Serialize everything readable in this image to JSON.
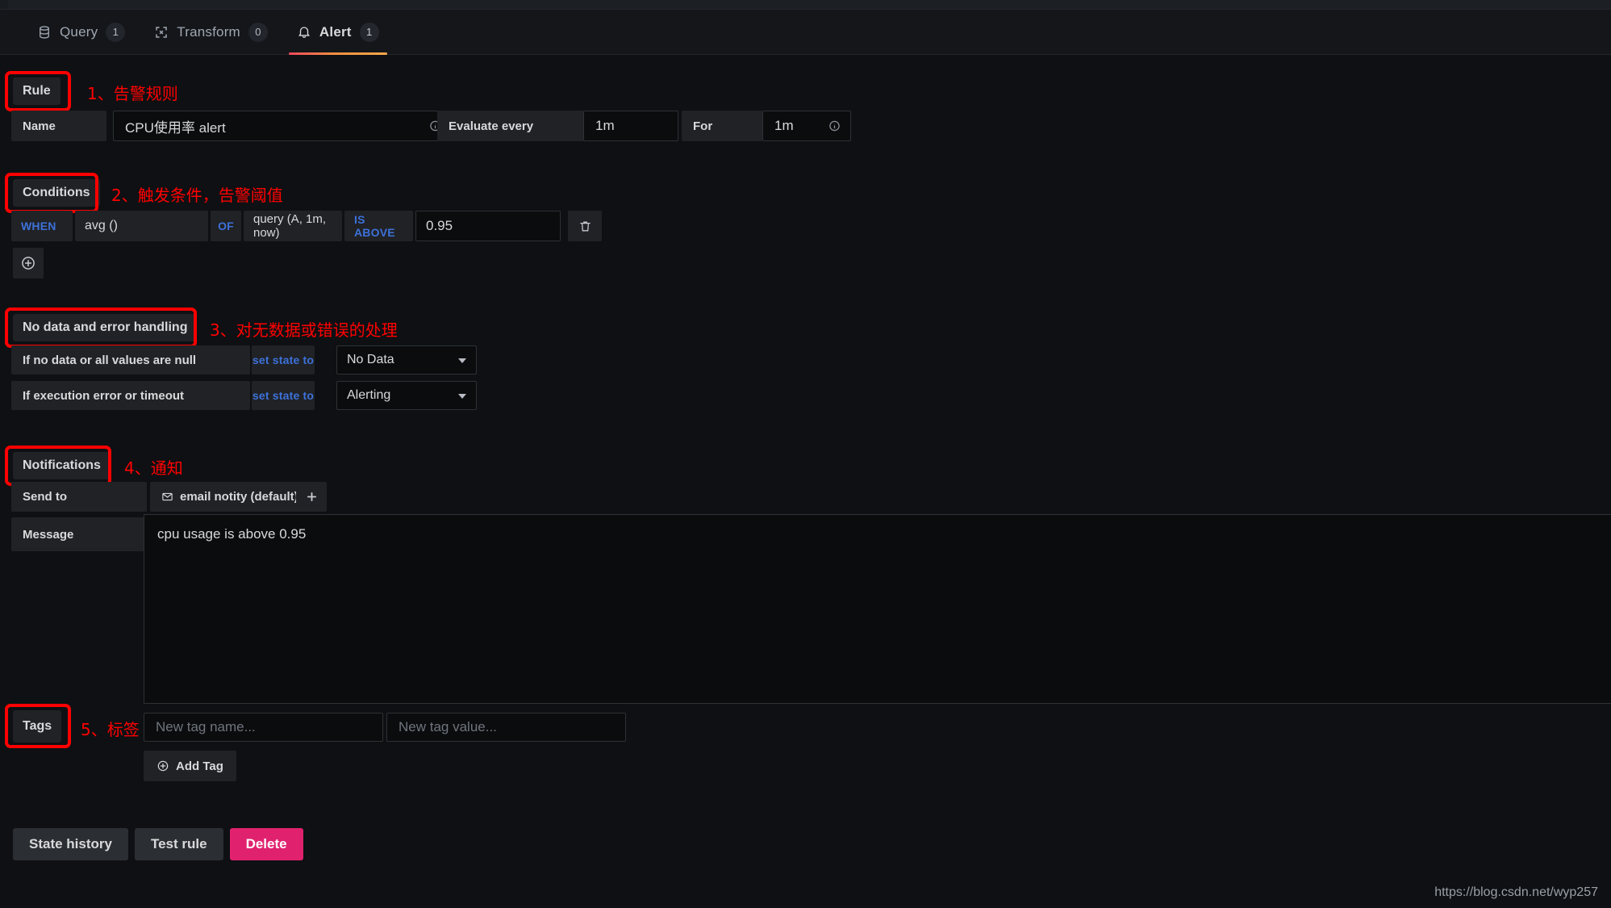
{
  "tabs": [
    {
      "label": "Query",
      "badge": "1",
      "icon": "database-icon",
      "active": false
    },
    {
      "label": "Transform",
      "badge": "0",
      "icon": "transform-icon",
      "active": false
    },
    {
      "label": "Alert",
      "badge": "1",
      "icon": "bell-icon",
      "active": true
    }
  ],
  "sections": {
    "rule": {
      "title": "Rule",
      "note": "1、告警规则"
    },
    "conditions": {
      "title": "Conditions",
      "note": "2、触发条件，告警阈值"
    },
    "nodata": {
      "title": "No data and error handling",
      "note": "3、对无数据或错误的处理"
    },
    "notifications": {
      "title": "Notifications",
      "note": "4、通知"
    },
    "tags": {
      "title": "Tags",
      "note": "5、标签"
    }
  },
  "rule": {
    "name_label": "Name",
    "name_value": "CPU使用率 alert",
    "evaluate_label": "Evaluate every",
    "evaluate_value": "1m",
    "for_label": "For",
    "for_value": "1m"
  },
  "condition": {
    "when": "WHEN",
    "reducer": "avg ()",
    "of": "OF",
    "query": "query (A, 1m, now)",
    "evaluator": "IS ABOVE",
    "threshold": "0.95",
    "delete_icon": "trash-icon",
    "add_icon": "plus-circle-icon"
  },
  "nodata": {
    "rows": [
      {
        "label": "If no data or all values are null",
        "mid": "set state to",
        "value": "No Data"
      },
      {
        "label": "If execution error or timeout",
        "mid": "set state to",
        "value": "Alerting"
      }
    ]
  },
  "notifications": {
    "send_to_label": "Send to",
    "channel": "email notity (default)",
    "channel_icon": "envelope-icon",
    "add_icon": "plus-icon",
    "message_label": "Message",
    "message_value": "cpu usage is above 0.95"
  },
  "tags": {
    "name_placeholder": "New tag name...",
    "value_placeholder": "New tag value...",
    "add_tag_label": "Add Tag",
    "add_tag_icon": "plus-circle-icon"
  },
  "footer": {
    "state_history": "State history",
    "test_rule": "Test rule",
    "delete": "Delete"
  },
  "watermark": "https://blog.csdn.net/wyp257",
  "colors": {
    "accent_tab": "#f28e42",
    "danger": "#e0226e",
    "annotation": "#ff0000",
    "link_blue": "#3d71d9",
    "panel_bg": "#141619",
    "input_bg": "#0b0c0e"
  }
}
